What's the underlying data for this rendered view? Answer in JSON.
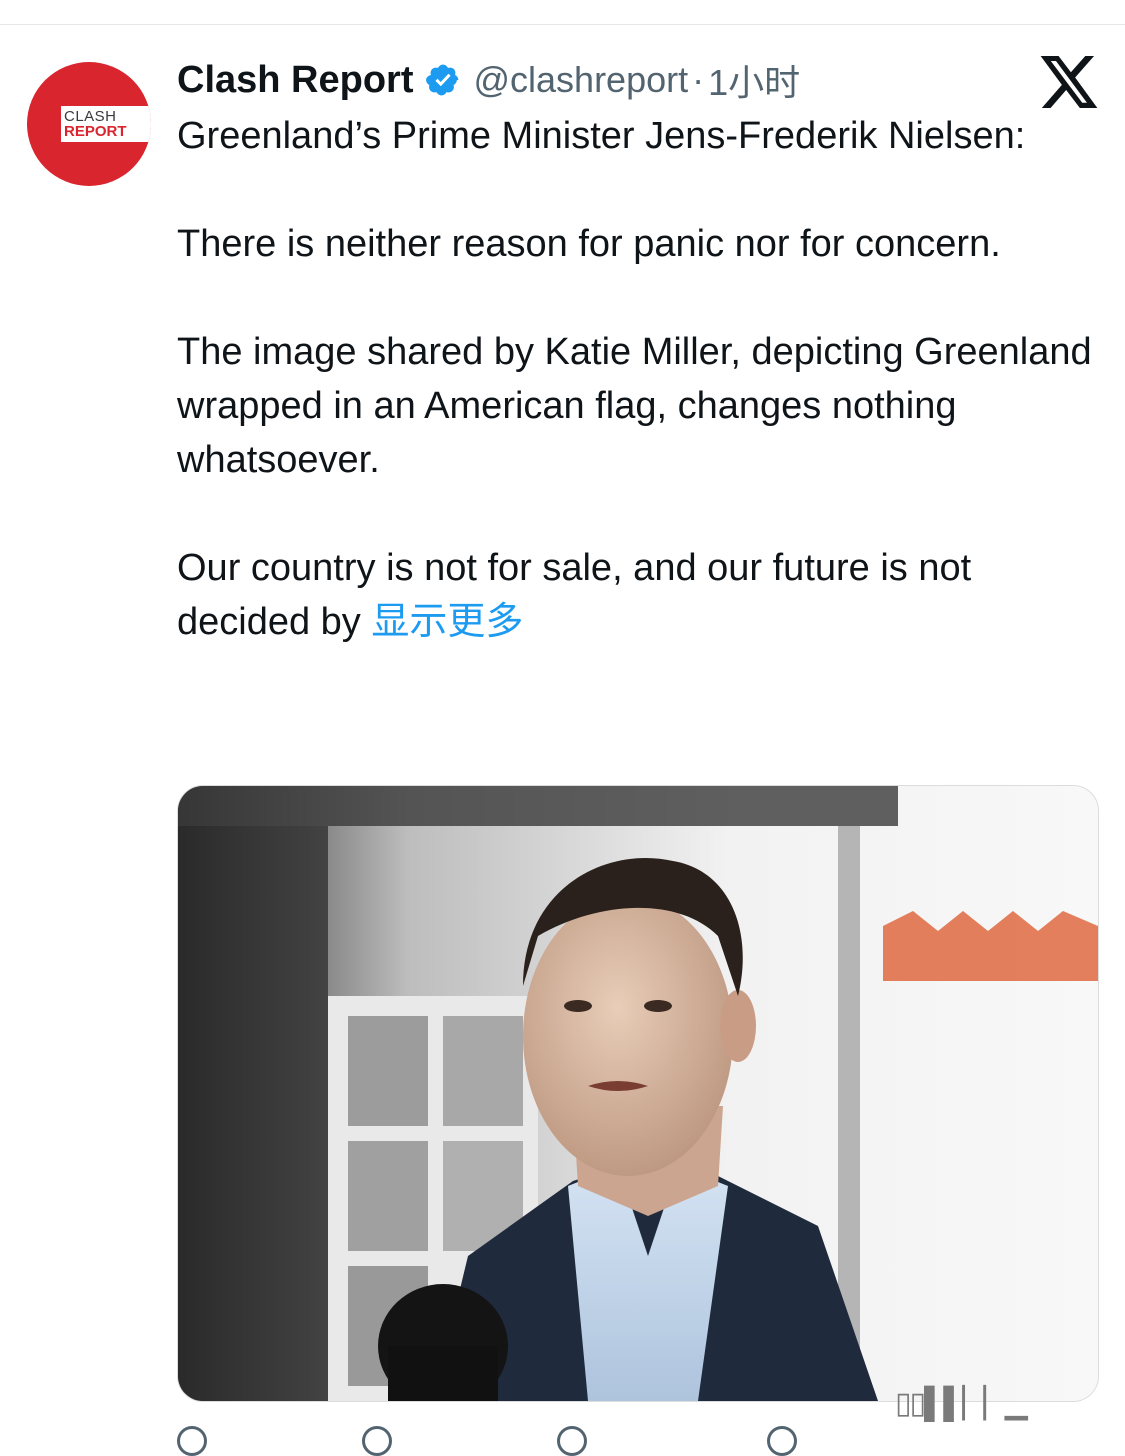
{
  "tweet": {
    "author_name": "Clash Report",
    "handle": "@clashreport",
    "separator": "·",
    "time": "1小时",
    "avatar_line1": "CLASH",
    "avatar_line2": "REPORT",
    "paragraphs": [
      "Greenland’s Prime Minister Jens-Frederik Nielsen:",
      "There is neither reason for panic nor for concern.",
      "The image shared by Katie Miller, depicting Greenland wrapped in an American flag, changes nothing whatsoever."
    ],
    "last_paragraph_text": "Our country is not for sale, and our future is not decided by ",
    "show_more": "显示更多"
  },
  "icons": {
    "verified": "verified-badge-icon",
    "x_logo": "x-logo-icon"
  },
  "colors": {
    "accent": "#1d9bf0",
    "avatar_red": "#d9252e",
    "secondary_text": "#536471"
  }
}
